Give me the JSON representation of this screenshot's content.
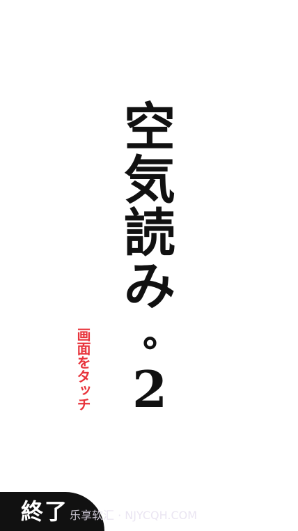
{
  "title": {
    "chars": [
      "空",
      "気",
      "読",
      "み"
    ],
    "dot": "。",
    "number": "2"
  },
  "tap_hint": {
    "text": "画面をタッチ",
    "color": "#e8333b"
  },
  "quit_button": {
    "label": "終了"
  },
  "watermark": {
    "text": "乐享软汇 · NJYCQH.COM"
  },
  "colors": {
    "background": "#ffffff",
    "title": "#111111",
    "button_bg": "#111111",
    "button_text": "#ffffff"
  }
}
